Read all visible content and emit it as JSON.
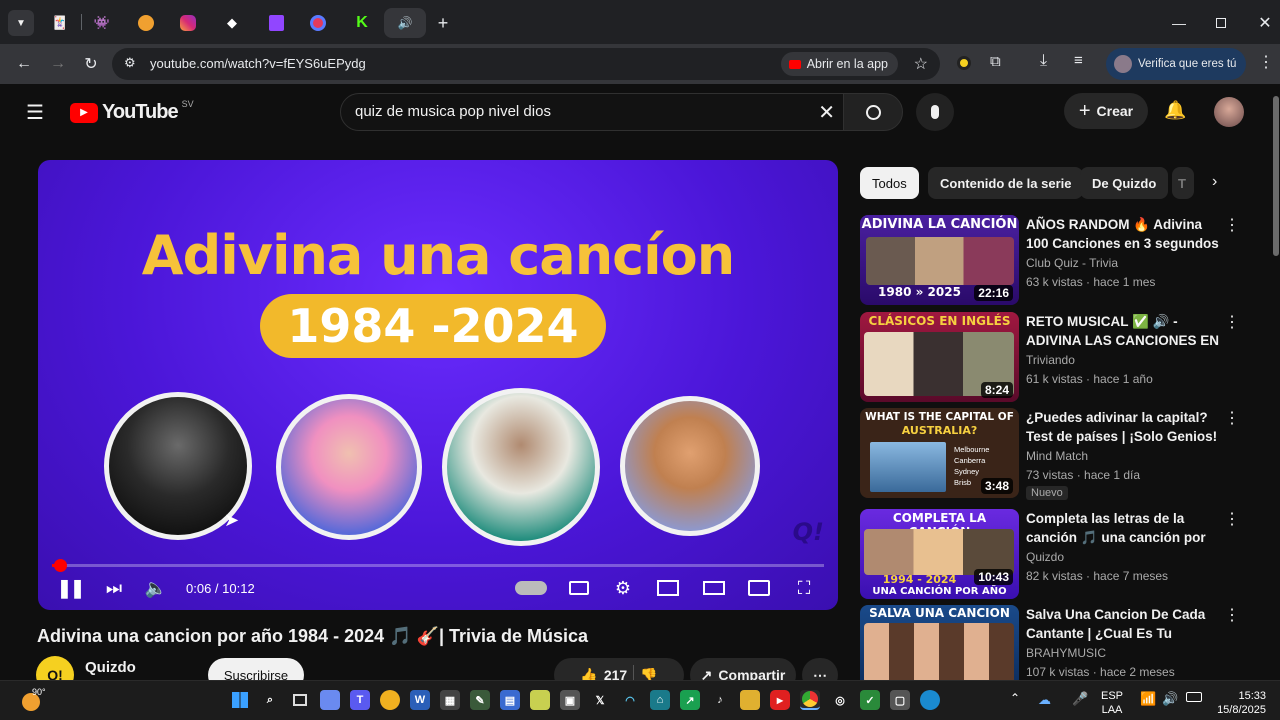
{
  "browser": {
    "url": "youtube.com/watch?v=fEYS6uEPydg",
    "open_in_app": "Abrir en la app",
    "verify": "Verifica que eres tú",
    "new_tab": "+"
  },
  "youtube": {
    "logo_text": "YouTube",
    "region": "SV",
    "search_value": "quiz de musica pop nivel dios",
    "create_label": "Crear"
  },
  "video": {
    "thumb_title": "Adivina una cancíon",
    "thumb_years": "1984 -2024",
    "thumb_logo": "Q!",
    "current_time": "0:06",
    "separator": " / ",
    "duration": "10:12",
    "progress": 0.0098,
    "title": "Adivina una cancion por año 1984 - 2024 🎵 🎸| Trivia de Música",
    "channel": "Quizdo",
    "subscribe": "Suscribirse",
    "likes": "217",
    "share": "Compartir"
  },
  "chips": [
    "Todos",
    "Contenido de la serie",
    "De Quizdo",
    "T"
  ],
  "recommendations": [
    {
      "title": "AÑOS RANDOM 🔥 Adivina 100 Canciones en 3 segundos 🎵 ...",
      "channel": "Club Quiz - Trivia",
      "meta": "63 k vistas · hace 1 mes",
      "duration": "22:16",
      "thumb_top": "ADIVINA LA CANCIÓN",
      "thumb_bottom": "1980 » 2025",
      "color": "#3a1a7a"
    },
    {
      "title": "RETO MUSICAL ✅ 🔊 - ADIVINA LAS CANCIONES EN ...",
      "channel": "Triviando",
      "meta": "61 k vistas · hace 1 año",
      "duration": "8:24",
      "thumb_top": "CLÁSICOS EN INGLÉS",
      "thumb_bottom": "",
      "color": "#7a1030"
    },
    {
      "title": "¿Puedes adivinar la capital? Test de países | ¡Solo Genios! ...",
      "channel": "Mind Match",
      "meta": "73 vistas · hace 1 día",
      "duration": "3:48",
      "badge": "Nuevo",
      "thumb_top": "WHAT IS THE CAPITAL OF",
      "thumb_sub": "AUSTRALIA?",
      "options": [
        "Melbourne",
        "Canberra",
        "Sydney",
        "Brisb"
      ],
      "color": "#3a2a1a"
    },
    {
      "title": "Completa las letras de la canción 🎵 una canción por ...",
      "channel": "Quizdo",
      "meta": "82 k vistas · hace 7 meses",
      "duration": "10:43",
      "thumb_top": "COMPLETA LA CANCIÓN",
      "thumb_bottom": "1994 - 2024",
      "thumb_bottom2": "UNA CANCIÓN POR AÑO",
      "color": "#5a1fc0"
    },
    {
      "title": "Salva Una Cancion De Cada Cantante | ¿Cual Es Tu Favorit...",
      "channel": "BRAHYMUSIC",
      "meta": "107 k vistas · hace 2 meses",
      "duration": "",
      "thumb_top": "SALVA UNA CANCION",
      "color": "#1a3a6a"
    }
  ],
  "taskbar": {
    "weather": "90°",
    "lang_top": "ESP",
    "lang_bottom": "LAA",
    "time": "15:33",
    "date": "15/8/2025"
  }
}
